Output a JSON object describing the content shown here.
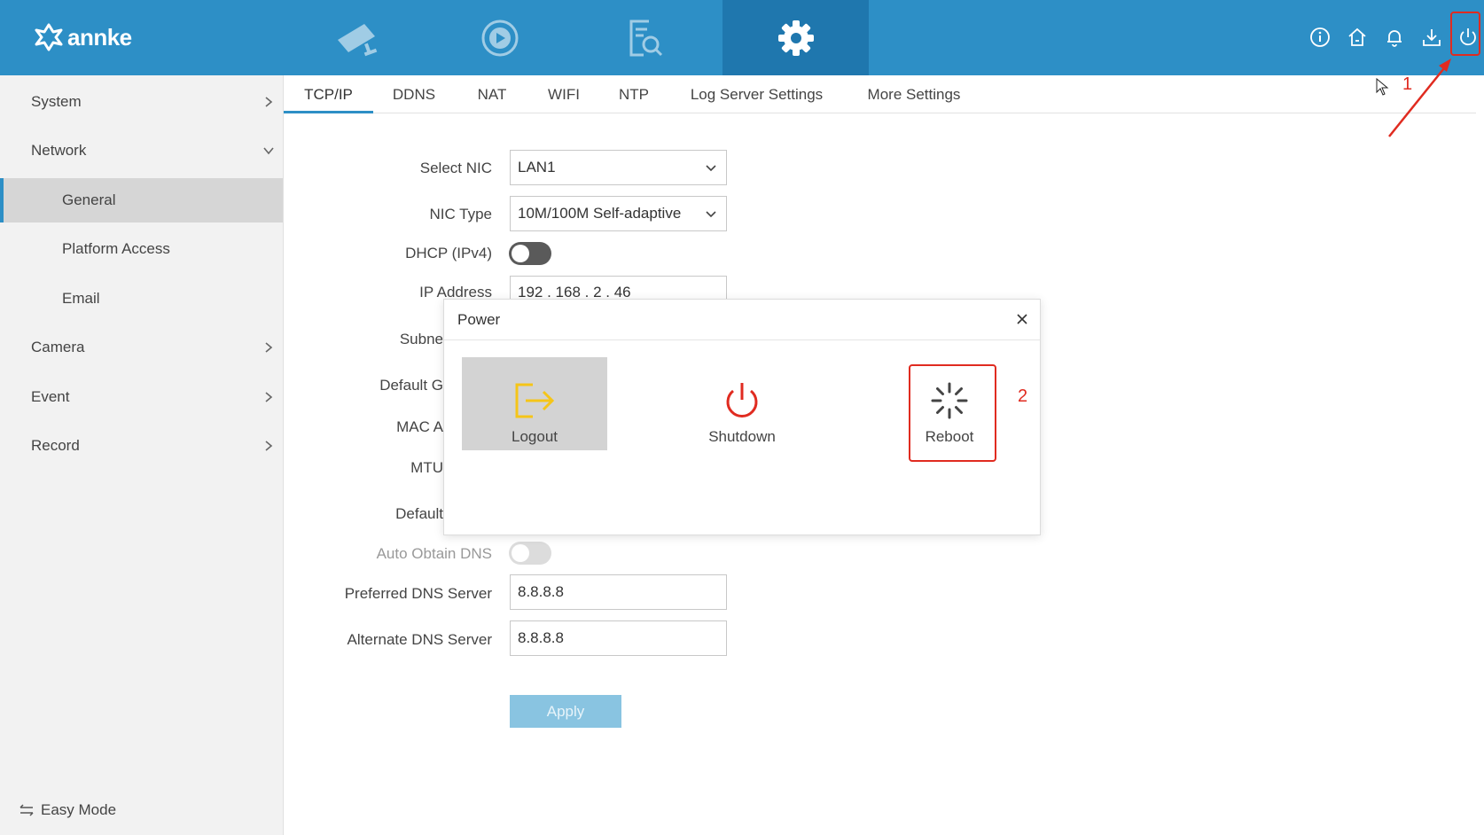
{
  "brand": {
    "name": "annke"
  },
  "colors": {
    "topbar": "#2d8fc6",
    "active_tab": "#1f77ae",
    "accent": "#2d8fc6",
    "annotation": "#e02b20",
    "logout_icon": "#f5c518",
    "shutdown_icon": "#e02b20"
  },
  "topnav": {
    "tabs": [
      {
        "icon": "camera-icon"
      },
      {
        "icon": "playback-icon"
      },
      {
        "icon": "search-file-icon"
      },
      {
        "icon": "gear-icon",
        "active": true
      }
    ],
    "right_icons": [
      "info-icon",
      "home-icon",
      "bell-icon",
      "download-icon",
      "power-icon"
    ]
  },
  "sidebar": {
    "items": [
      {
        "label": "System"
      },
      {
        "label": "Network"
      },
      {
        "label": "General"
      },
      {
        "label": "Platform Access"
      },
      {
        "label": "Email"
      },
      {
        "label": "Camera"
      },
      {
        "label": "Event"
      },
      {
        "label": "Record"
      }
    ],
    "easy_mode": "Easy Mode"
  },
  "subtabs": [
    "TCP/IP",
    "DDNS",
    "NAT",
    "WIFI",
    "NTP",
    "Log Server Settings",
    "More Settings"
  ],
  "form": {
    "select_nic": {
      "label": "Select NIC",
      "value": "LAN1"
    },
    "nic_type": {
      "label": "NIC Type",
      "value": "10M/100M Self-adaptive"
    },
    "dhcp": {
      "label": "DHCP (IPv4)"
    },
    "ip_address": {
      "label": "IP Address",
      "value": "192 . 168 . 2 . 46"
    },
    "subnet": {
      "label": "Subne"
    },
    "default_gateway": {
      "label": "Default G"
    },
    "mac": {
      "label": "MAC A"
    },
    "mtu": {
      "label": "MTU"
    },
    "default_route": {
      "label": "Default"
    },
    "auto_dns": {
      "label": "Auto Obtain DNS"
    },
    "preferred_dns": {
      "label": "Preferred DNS Server",
      "value": "8.8.8.8"
    },
    "alternate_dns": {
      "label": "Alternate DNS Server",
      "value": "8.8.8.8"
    },
    "apply": "Apply"
  },
  "dialog": {
    "title": "Power",
    "options": [
      {
        "label": "Logout"
      },
      {
        "label": "Shutdown"
      },
      {
        "label": "Reboot"
      }
    ]
  },
  "annotations": {
    "step1": "1",
    "step2": "2"
  }
}
